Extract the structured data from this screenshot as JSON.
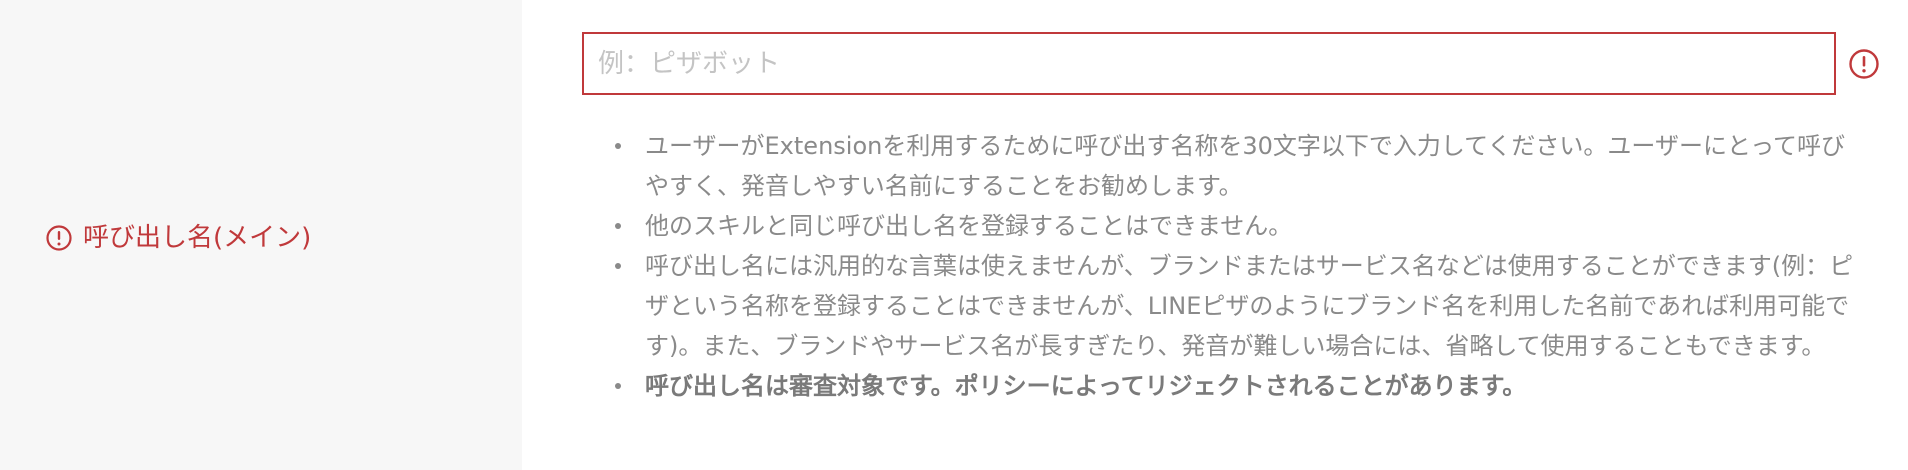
{
  "field": {
    "label": "呼び出し名(メイン)",
    "error_icon": "exclamation-circle-icon",
    "placeholder": "例：ピザボット",
    "value": ""
  },
  "notes": [
    "ユーザーがExtensionを利用するために呼び出す名称を30文字以下で入力してください。ユーザーにとって呼びやすく、発音しやすい名前にすることをお勧めします。",
    "他のスキルと同じ呼び出し名を登録することはできません。",
    "呼び出し名には汎用的な言葉は使えませんが、ブランドまたはサービス名などは使用することができます(例：ピザという名称を登録することはできませんが、LINEピザのようにブランド名を利用した名前であれば利用可能です)。また、ブランドやサービス名が長すぎたり、発音が難しい場合には、省略して使用することもできます。",
    "呼び出し名は審査対象です。ポリシーによってリジェクトされることがあります。"
  ],
  "colors": {
    "error": "#c0393b",
    "text_muted": "#8a8a8a",
    "label_bg": "#f7f7f7"
  }
}
